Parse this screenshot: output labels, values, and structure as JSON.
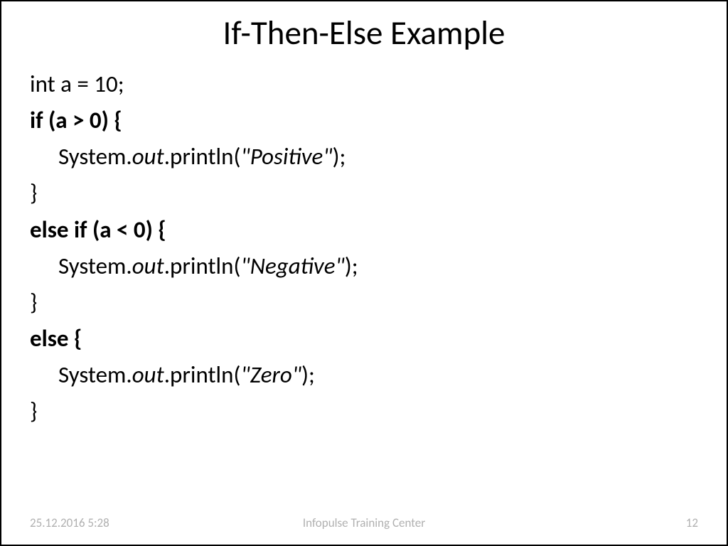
{
  "slide": {
    "title": "If-Then-Else Example",
    "code": {
      "line1": "int a = 10;",
      "line2": "if (a > 0) {",
      "line3_part1": "System.",
      "line3_part2": "out",
      "line3_part3": ".println(",
      "line3_part4": "\"Positive\"",
      "line3_part5": ");",
      "line4": "}",
      "line5": "else if (a < 0) {",
      "line6_part1": "System.",
      "line6_part2": "out",
      "line6_part3": ".println(",
      "line6_part4": "\"Negative\"",
      "line6_part5": ");",
      "line7": "}",
      "line8": "else {",
      "line9_part1": "System.",
      "line9_part2": "out",
      "line9_part3": ".println(",
      "line9_part4": "\"Zero\"",
      "line9_part5": ");",
      "line10": "}"
    },
    "footer": {
      "date": "25.12.2016 5:28",
      "center": "Infopulse Training Center",
      "page": "12"
    }
  }
}
